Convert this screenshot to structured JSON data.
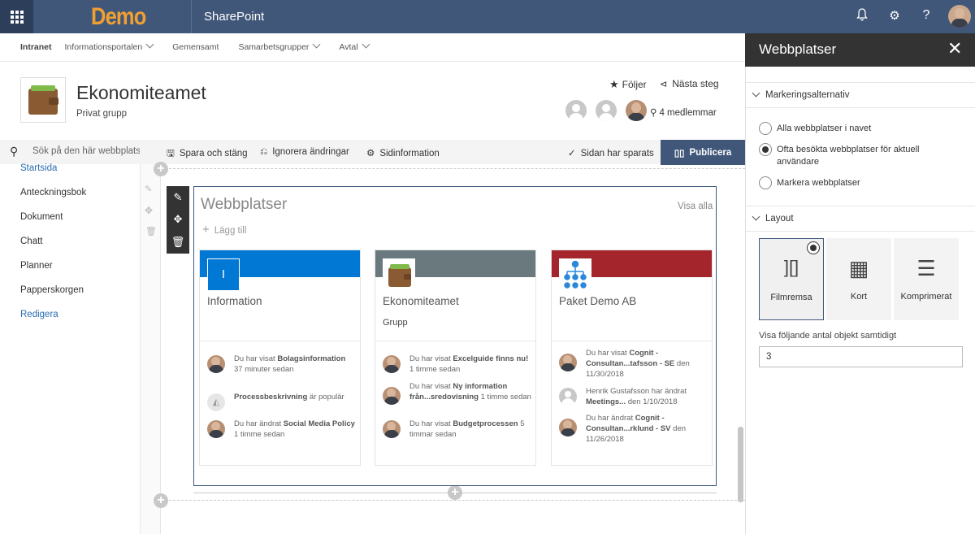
{
  "suite": {
    "logo": "Demo",
    "app_name": "SharePoint"
  },
  "topnav": {
    "items": [
      {
        "label": "Intranet",
        "dropdown": false
      },
      {
        "label": "Informationsportalen",
        "dropdown": true
      },
      {
        "label": "Gemensamt",
        "dropdown": false
      },
      {
        "label": "Samarbetsgrupper",
        "dropdown": true
      },
      {
        "label": "Avtal",
        "dropdown": true
      }
    ]
  },
  "site": {
    "title": "Ekonomiteamet",
    "subtitle": "Privat grupp",
    "follow_label": "Följer",
    "next_step_label": "Nästa steg",
    "members_label": "4 medlemmar"
  },
  "leftnav": {
    "search_placeholder": "Sök på den här webbplats",
    "items": [
      "Startsida",
      "Anteckningsbok",
      "Dokument",
      "Chatt",
      "Planner",
      "Papperskorgen",
      "Redigera"
    ]
  },
  "commandbar": {
    "save_close": "Spara och stäng",
    "discard": "Ignorera ändringar",
    "page_details": "Sidinformation",
    "saved_status": "Sidan har sparats",
    "publish": "Publicera"
  },
  "webpart": {
    "title": "Webbplatser",
    "see_all": "Visa alla",
    "add": "Lägg till",
    "cards": [
      {
        "title": "Information",
        "subtitle": "",
        "band_color": "#0078d4",
        "logo_letter": "I",
        "activities": [
          {
            "prefix": "Du har visat ",
            "bold": "Bolagsinformation",
            "suffix": " 37 minuter sedan",
            "icon": "photo"
          },
          {
            "prefix": "",
            "bold": "Processbeskrivning",
            "suffix": " är populär",
            "icon": "image-icon"
          },
          {
            "prefix": "Du har ändrat ",
            "bold": "Social Media Policy",
            "suffix": " 1 timme sedan",
            "icon": "photo"
          }
        ]
      },
      {
        "title": "Ekonomiteamet",
        "subtitle": "Grupp",
        "band_color": "#69797e",
        "logo_letter": "",
        "activities": [
          {
            "prefix": "Du har visat ",
            "bold": "Excelguide finns nu!",
            "suffix": " 1 timme sedan",
            "icon": "photo"
          },
          {
            "prefix": "Du har visat ",
            "bold": "Ny information från...sredovisning",
            "suffix": " 1 timme sedan",
            "icon": "photo"
          },
          {
            "prefix": "Du har visat ",
            "bold": "Budgetprocessen",
            "suffix": " 5 timmar sedan",
            "icon": "photo"
          }
        ]
      },
      {
        "title": "Paket Demo AB",
        "subtitle": "",
        "band_color": "#a4262c",
        "logo_letter": "",
        "activities": [
          {
            "prefix": "Du har visat ",
            "bold": "Cognit - Consultan...tafsson - SE",
            "suffix": " den 11/30/2018",
            "icon": "photo"
          },
          {
            "prefix": "Henrik Gustafsson har ändrat ",
            "bold": "Meetings...",
            "suffix": " den 1/10/2018",
            "icon": "person"
          },
          {
            "prefix": "Du har ändrat ",
            "bold": "Cognit - Consultan...rklund - SV",
            "suffix": " den 11/26/2018",
            "icon": "photo"
          }
        ]
      }
    ]
  },
  "panel": {
    "title": "Webbplatser",
    "selection_section": "Markeringsalternativ",
    "options": [
      {
        "label": "Alla webbplatser i navet",
        "selected": false
      },
      {
        "label": "Ofta besökta webbplatser för aktuell användare",
        "selected": true
      },
      {
        "label": "Markera webbplatser",
        "selected": false
      }
    ],
    "layout_section": "Layout",
    "layouts": [
      {
        "label": "Filmremsa",
        "selected": true
      },
      {
        "label": "Kort",
        "selected": false
      },
      {
        "label": "Komprimerat",
        "selected": false
      }
    ],
    "count_label": "Visa följande antal objekt samtidigt",
    "count_value": "3"
  }
}
